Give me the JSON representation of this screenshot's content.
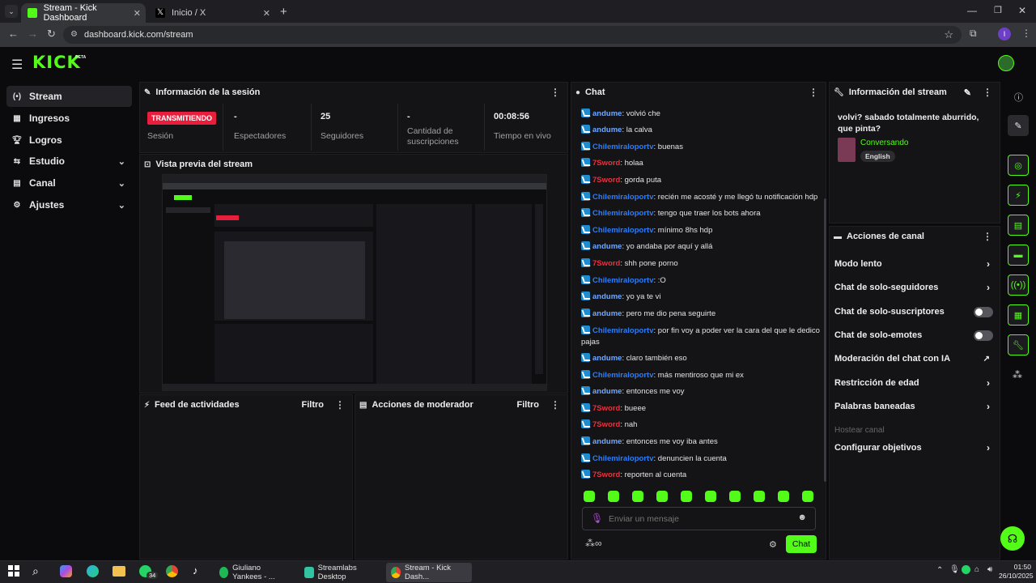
{
  "browser": {
    "tabs": [
      {
        "title": "Stream - Kick Dashboard"
      },
      {
        "title": "Inicio / X"
      }
    ],
    "url": "dashboard.kick.com/stream",
    "profile_initial": "I"
  },
  "app": {
    "logo": "KICK",
    "beta": "BETA"
  },
  "sidebar": {
    "items": [
      {
        "label": "Stream",
        "icon": "stream-icon"
      },
      {
        "label": "Ingresos",
        "icon": "money-icon"
      },
      {
        "label": "Logros",
        "icon": "trophy-icon"
      },
      {
        "label": "Estudio",
        "icon": "studio-icon"
      },
      {
        "label": "Canal",
        "icon": "channel-icon"
      },
      {
        "label": "Ajustes",
        "icon": "gear-icon"
      }
    ]
  },
  "session": {
    "title": "Información de la sesión",
    "status_badge": "TRANSMITIENDO",
    "status_label": "Sesión",
    "stats": [
      {
        "value": "-",
        "label": "Espectadores"
      },
      {
        "value": "25",
        "label": "Seguidores"
      },
      {
        "value": "-",
        "label": "Cantidad de suscripciones"
      },
      {
        "value": "00:08:56",
        "label": "Tiempo en vivo"
      }
    ]
  },
  "preview": {
    "title": "Vista previa del stream"
  },
  "activity": {
    "title": "Feed de actividades",
    "filter": "Filtro"
  },
  "modactions": {
    "title": "Acciones de moderador",
    "filter": "Filtro"
  },
  "chat": {
    "title": "Chat",
    "messages": [
      {
        "user": "andume",
        "text": "volvió che",
        "color": "#6fa8ff"
      },
      {
        "user": "andume",
        "text": "la calva",
        "color": "#6fa8ff"
      },
      {
        "user": "Chilemiraloportv",
        "text": "buenas",
        "color": "#2e7cf6"
      },
      {
        "user": "7Sword",
        "text": "holaa",
        "color": "#e8313f"
      },
      {
        "user": "7Sword",
        "text": "gorda puta",
        "color": "#e8313f"
      },
      {
        "user": "Chilemiraloportv",
        "text": "recién me acosté y me llegó tu notificación hdp",
        "color": "#2e7cf6"
      },
      {
        "user": "Chilemiraloportv",
        "text": "tengo que traer los bots ahora",
        "color": "#2e7cf6"
      },
      {
        "user": "Chilemiraloportv",
        "text": "mínimo 8hs hdp",
        "color": "#2e7cf6"
      },
      {
        "user": "andume",
        "text": "yo andaba por aquí y allá",
        "color": "#6fa8ff"
      },
      {
        "user": "7Sword",
        "text": "shh pone porno",
        "color": "#e8313f"
      },
      {
        "user": "Chilemiraloportv",
        "text": ":O",
        "color": "#2e7cf6"
      },
      {
        "user": "andume",
        "text": "yo ya te vi",
        "color": "#6fa8ff"
      },
      {
        "user": "andume",
        "text": "pero me dio pena seguirte",
        "color": "#6fa8ff"
      },
      {
        "user": "Chilemiraloportv",
        "text": "por fin voy a poder ver la cara del que le dedico pajas",
        "color": "#2e7cf6"
      },
      {
        "user": "andume",
        "text": "claro también eso",
        "color": "#6fa8ff"
      },
      {
        "user": "Chilemiraloportv",
        "text": "más mentiroso que mi ex",
        "color": "#2e7cf6"
      },
      {
        "user": "andume",
        "text": "entonces me voy",
        "color": "#6fa8ff"
      },
      {
        "user": "7Sword",
        "text": "bueee",
        "color": "#e8313f"
      },
      {
        "user": "7Sword",
        "text": "nah",
        "color": "#e8313f"
      },
      {
        "user": "andume",
        "text": "entonces me voy iba antes",
        "color": "#6fa8ff"
      },
      {
        "user": "Chilemiraloportv",
        "text": "denuncien la cuenta",
        "color": "#2e7cf6"
      },
      {
        "user": "7Sword",
        "text": "reporten al cuenta",
        "color": "#e8313f"
      }
    ],
    "input_placeholder": "Enviar un mensaje",
    "send_label": "Chat"
  },
  "stream_info": {
    "title": "Información del stream",
    "stream_title": "volvi? sabado totalmente aburrido, que pinta?",
    "category": "Conversando",
    "language": "English"
  },
  "channel_actions": {
    "title": "Acciones de canal",
    "items": [
      {
        "label": "Modo lento",
        "control": "chevron"
      },
      {
        "label": "Chat de solo-seguidores",
        "control": "chevron"
      },
      {
        "label": "Chat de solo-suscriptores",
        "control": "toggle"
      },
      {
        "label": "Chat de solo-emotes",
        "control": "toggle"
      },
      {
        "label": "Moderación del chat con IA",
        "control": "external"
      },
      {
        "label": "Restricción de edad",
        "control": "chevron"
      },
      {
        "label": "Palabras baneadas",
        "control": "chevron"
      },
      {
        "label": "Hostear canal",
        "control": "disabled"
      },
      {
        "label": "Configurar objetivos",
        "control": "chevron"
      }
    ]
  },
  "taskbar": {
    "apps": [
      {
        "label": "Giuliano Yankees - ..."
      },
      {
        "label": "Streamlabs Desktop"
      },
      {
        "label": "Stream - Kick Dash..."
      }
    ],
    "whatsapp_count": "34",
    "time": "01:50",
    "date": "26/10/2025"
  },
  "colors": {
    "accent": "#53fc18",
    "live": "#e91e3c",
    "panel": "#141417"
  }
}
